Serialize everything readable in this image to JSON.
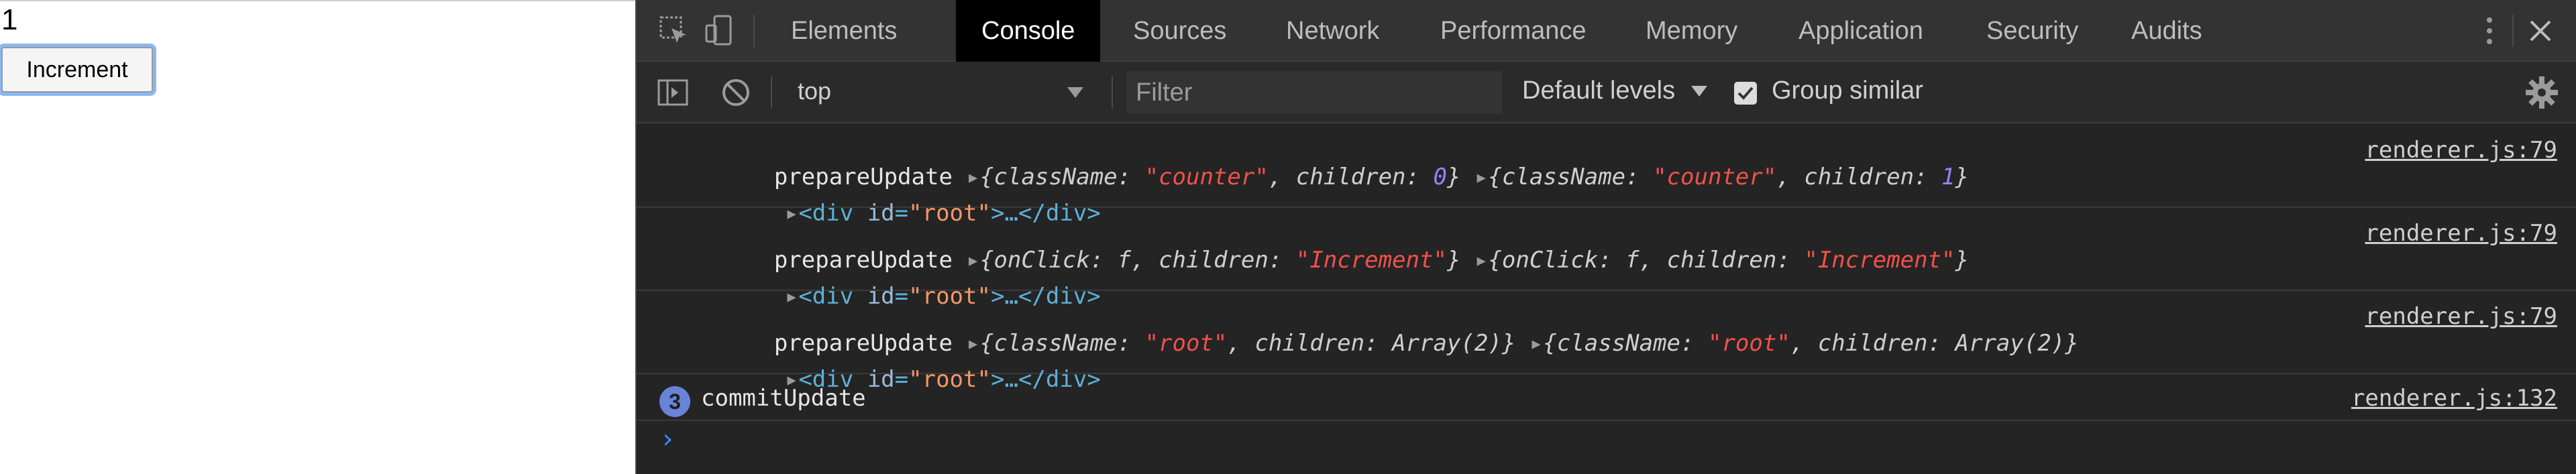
{
  "app": {
    "counter": "1",
    "increment_label": "Increment"
  },
  "devtools": {
    "tabs": [
      "Elements",
      "Console",
      "Sources",
      "Network",
      "Performance",
      "Memory",
      "Application",
      "Security",
      "Audits"
    ],
    "active_tab": "Console",
    "toolbar": {
      "context": "top",
      "filter_placeholder": "Filter",
      "levels": "Default levels",
      "group_similar": "Group similar",
      "group_similar_checked": true
    },
    "console": {
      "messages": [
        {
          "name": "prepareUpdate",
          "a_key1": "className",
          "a_val1": "\"counter\"",
          "a_key2": "children",
          "a_val2": "0",
          "b_key1": "className",
          "b_val1": "\"counter\"",
          "b_key2": "children",
          "b_val2": "1",
          "node_tag": "div",
          "node_attr": "id",
          "node_val": "\"root\"",
          "source": "renderer.js:79"
        },
        {
          "name": "prepareUpdate",
          "a_key1": "onClick",
          "a_val1": "f",
          "a_key2": "children",
          "a_val2": "\"Increment\"",
          "b_key1": "onClick",
          "b_val1": "f",
          "b_key2": "children",
          "b_val2": "\"Increment\"",
          "node_tag": "div",
          "node_attr": "id",
          "node_val": "\"root\"",
          "source": "renderer.js:79"
        },
        {
          "name": "prepareUpdate",
          "a_key1": "className",
          "a_val1": "\"root\"",
          "a_key2": "children",
          "a_val2": "Array(2)",
          "b_key1": "className",
          "b_val1": "\"root\"",
          "b_key2": "children",
          "b_val2": "Array(2)",
          "node_tag": "div",
          "node_attr": "id",
          "node_val": "\"root\"",
          "source": "renderer.js:79"
        }
      ],
      "commit": {
        "count": "3",
        "name": "commitUpdate",
        "source": "renderer.js:132"
      },
      "prompt": "›"
    },
    "colors": {
      "background": "#242424",
      "tabbar": "#333333",
      "string": "#f2504c",
      "number": "#9980ff",
      "tag": "#5db0d7"
    }
  }
}
